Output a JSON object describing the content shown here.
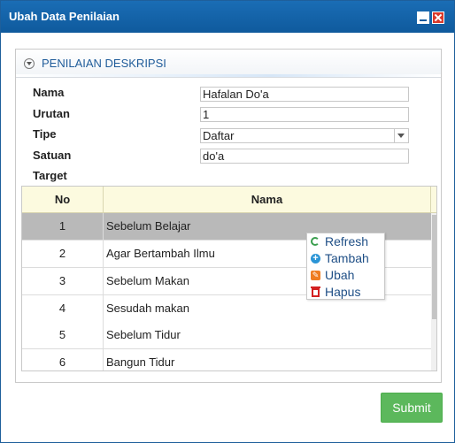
{
  "dialog": {
    "title": "Ubah Data Penilaian"
  },
  "panel": {
    "title": "PENILAIAN DESKRIPSI"
  },
  "form": {
    "nama_label": "Nama",
    "nama_value": "Hafalan Do'a",
    "urutan_label": "Urutan",
    "urutan_value": "1",
    "tipe_label": "Tipe",
    "tipe_value": "Daftar",
    "satuan_label": "Satuan",
    "satuan_value": "do'a",
    "target_label": "Target"
  },
  "grid": {
    "columns": [
      "No",
      "Nama"
    ],
    "rows": [
      {
        "no": "1",
        "nama": "Sebelum Belajar"
      },
      {
        "no": "2",
        "nama": "Agar Bertambah Ilmu"
      },
      {
        "no": "3",
        "nama": "Sebelum Makan"
      },
      {
        "no": "4",
        "nama": "Sesudah makan"
      },
      {
        "no": "5",
        "nama": "Sebelum Tidur"
      },
      {
        "no": "6",
        "nama": "Bangun Tidur"
      }
    ],
    "selected_row_index": 0
  },
  "context_menu": {
    "items": [
      {
        "label": "Refresh",
        "icon": "refresh-icon",
        "color": "#3a9e4e"
      },
      {
        "label": "Tambah",
        "icon": "add-icon",
        "color": "#2b95d6"
      },
      {
        "label": "Ubah",
        "icon": "edit-icon",
        "color": "#ef7d22"
      },
      {
        "label": "Hapus",
        "icon": "trash-icon",
        "color": "#d32020"
      }
    ]
  },
  "footer": {
    "submit_label": "Submit"
  },
  "colors": {
    "titlebar": "#1565ab",
    "panel_title": "#1f5c9a",
    "grid_header": "#fcfadf",
    "selected_row": "#b9b9b9",
    "submit": "#5cb85c"
  }
}
